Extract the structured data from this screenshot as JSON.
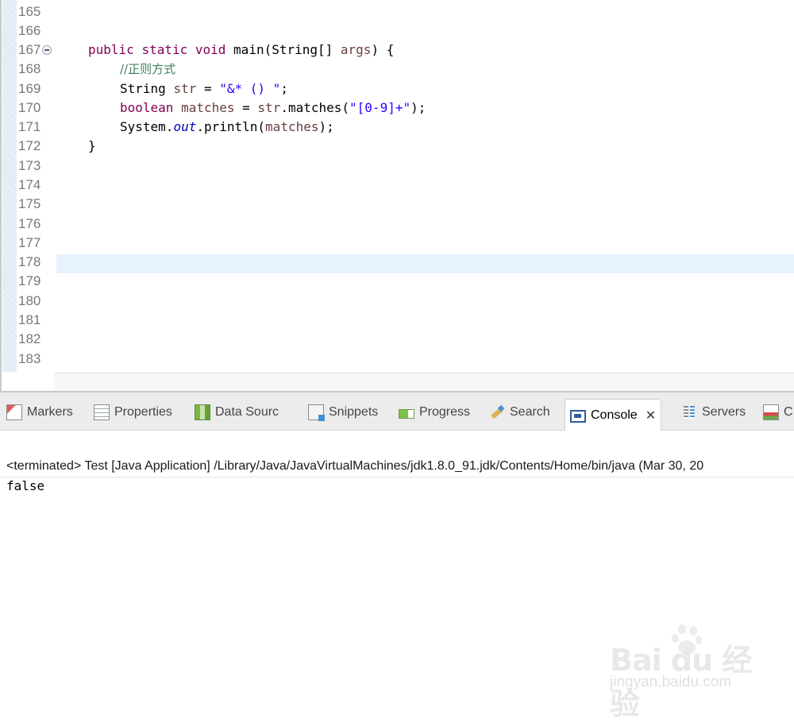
{
  "editor": {
    "line_numbers": [
      "165",
      "166",
      "167",
      "168",
      "169",
      "170",
      "171",
      "172",
      "173",
      "174",
      "175",
      "176",
      "177",
      "178",
      "179",
      "180",
      "181",
      "182",
      "183"
    ],
    "code": {
      "line167": {
        "kw1": "public",
        "kw2": "static",
        "kw3": "void",
        "name": "main(String[] ",
        "var": "args",
        "end": ") {"
      },
      "line168": {
        "comment": "//正则方式"
      },
      "line169": {
        "type": "String ",
        "var": "str",
        "op": " = ",
        "string": "\"&* () \"",
        "end": ";"
      },
      "line170": {
        "kw": "boolean",
        "sp": " ",
        "var": "matches",
        "op": " = ",
        "recv": "str",
        "call": ".matches(",
        "string": "\"[0-9]+\"",
        "end": ");"
      },
      "line171": {
        "cls": "System.",
        "field": "out",
        "call": ".println(",
        "var": "matches",
        "end": ");"
      },
      "line172": {
        "text": "}"
      }
    }
  },
  "tabs": {
    "markers": "Markers",
    "properties": "Properties",
    "data_source": "Data Sourc",
    "snippets": "Snippets",
    "progress": "Progress",
    "search": "Search",
    "console": "Console",
    "servers": "Servers",
    "coverage": "C"
  },
  "console": {
    "header": "<terminated> Test [Java Application] /Library/Java/JavaVirtualMachines/jdk1.8.0_91.jdk/Contents/Home/bin/java (Mar 30, 20",
    "output": "false"
  },
  "watermark": {
    "logo": "Bai du 经验",
    "url": "jingyan.baidu.com"
  },
  "icons": {
    "fold": "collapse-minus-icon",
    "close": "close-icon"
  }
}
